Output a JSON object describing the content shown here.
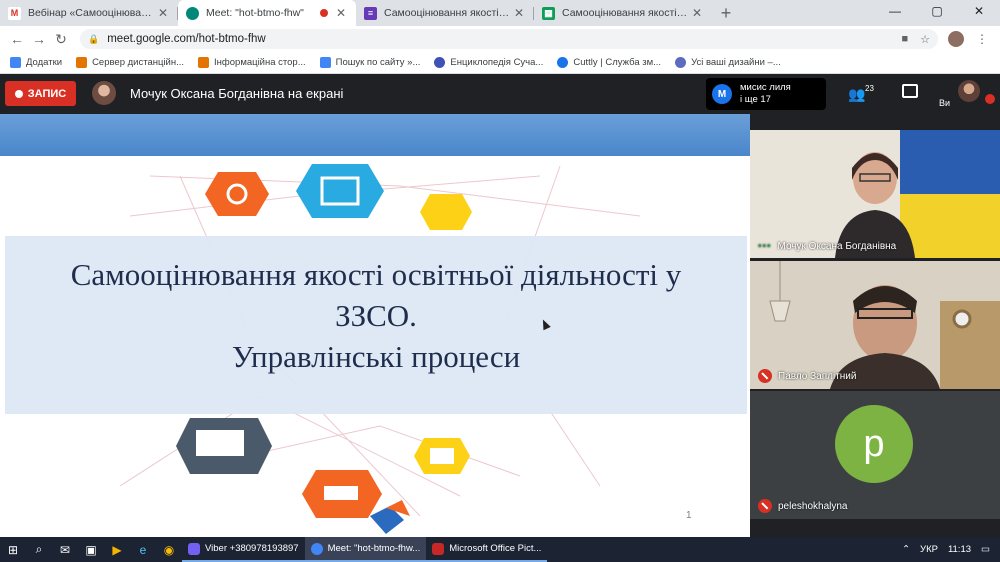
{
  "browser": {
    "tabs": [
      {
        "title": "Вебінар «Самооцінювання якос",
        "favicon": "gmail-icon",
        "color": "#d93025",
        "active": false
      },
      {
        "title": "Meet: \"hot-btmo-fhw\"",
        "favicon": "meet-icon",
        "color": "#00897b",
        "active": true,
        "recording": true
      },
      {
        "title": "Самооцінювання якості освітн",
        "favicon": "forms-icon",
        "color": "#673ab7",
        "active": false
      },
      {
        "title": "Самооцінювання якості освітн",
        "favicon": "sheets-icon",
        "color": "#0f9d58",
        "active": false
      }
    ],
    "new_tab": "+",
    "window_controls": {
      "minimize": "—",
      "maximize": "▢",
      "close": "✕"
    },
    "url": "meet.google.com/hot-btmo-fhw",
    "bookmarks": [
      {
        "label": "Додатки",
        "color": "#4285f4"
      },
      {
        "label": "Сервер дистанційн...",
        "color": "#e37400"
      },
      {
        "label": "Інформаційна стор...",
        "color": "#e37400"
      },
      {
        "label": "Пошук по сайту »...",
        "color": "#4285f4"
      },
      {
        "label": "Енциклопедія Суча...",
        "color": "#3f51b5"
      },
      {
        "label": "Cuttly | Служба зм...",
        "color": "#1a73e8"
      },
      {
        "label": "Усі ваші дизайни –...",
        "color": "#5c6bc0"
      }
    ]
  },
  "meet": {
    "record_label": "ЗАПИС",
    "presenter_text": "Мочук Оксана Богданівна на екрані",
    "chip": {
      "initial": "M",
      "line1": "мисис лиля",
      "line2": "і ще 17"
    },
    "people_count": "23",
    "me_label": "Ви",
    "slide": {
      "title_line1": "Самооцінювання якості освітньої діяльності у",
      "title_line2": "ЗЗСО.",
      "title_line3": "Управлінські процеси",
      "page_number": "1"
    },
    "tiles": [
      {
        "name": "Мочук Оксана Богданівна",
        "indicator": "•••"
      },
      {
        "name": "Павло Заплітний",
        "muted": true
      },
      {
        "name": "peleshokhalyna",
        "muted": true,
        "avatar_letter": "p",
        "avatar_color": "#7cb342"
      }
    ]
  },
  "taskbar": {
    "apps": [
      {
        "label": "Viber +380978193897",
        "color": "#7360f2",
        "active": false
      },
      {
        "label": "Meet: \"hot-btmo-fhw...",
        "color": "#4285f4",
        "active": true
      },
      {
        "label": "Microsoft Office Pict...",
        "color": "#c62828",
        "active": false
      }
    ],
    "language": "УКР",
    "time": "11:13"
  }
}
